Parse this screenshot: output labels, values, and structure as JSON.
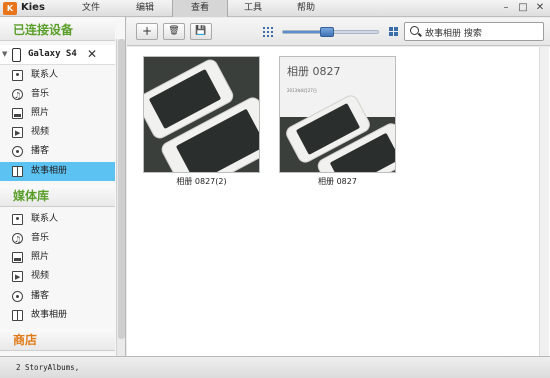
{
  "app": {
    "logo_text": "K",
    "name": "Kies"
  },
  "menu": [
    {
      "label": "文件"
    },
    {
      "label": "编辑"
    },
    {
      "label": "查看",
      "active": true
    },
    {
      "label": "工具"
    },
    {
      "label": "帮助"
    }
  ],
  "window": {
    "minimize": "–",
    "maximize": "□",
    "close": "✕"
  },
  "sidebar": {
    "connected_header": "已连接设备",
    "device": {
      "name": "Galaxy S4",
      "collapse_glyph": "▼",
      "close_glyph": "✕"
    },
    "device_items": [
      {
        "label": "联系人",
        "icon": "contact-icon"
      },
      {
        "label": "音乐",
        "icon": "music-icon"
      },
      {
        "label": "照片",
        "icon": "photo-icon"
      },
      {
        "label": "视频",
        "icon": "video-icon"
      },
      {
        "label": "播客",
        "icon": "podcast-icon"
      },
      {
        "label": "故事相册",
        "icon": "story-album-icon",
        "selected": true
      }
    ],
    "library_header": "媒体库",
    "library_items": [
      {
        "label": "联系人",
        "icon": "contact-icon"
      },
      {
        "label": "音乐",
        "icon": "music-icon"
      },
      {
        "label": "照片",
        "icon": "photo-icon"
      },
      {
        "label": "视频",
        "icon": "video-icon"
      },
      {
        "label": "播客",
        "icon": "podcast-icon"
      },
      {
        "label": "故事相册",
        "icon": "story-album-icon"
      }
    ],
    "store_header": "商店"
  },
  "toolbar": {
    "add_glyph": "+",
    "delete_glyph": "🗑",
    "save_glyph": "💾",
    "search_value": "故事相册 搜索"
  },
  "albums": [
    {
      "label": "相册 0827(2)"
    },
    {
      "label": "相册 0827",
      "card_title": "相册 0827",
      "card_sub": "2013年8月27日"
    }
  ],
  "status": {
    "text": "2 StoryAlbums,"
  },
  "colors": {
    "selected": "#5cc2f2",
    "header_green": "#5b9f2b",
    "store_orange": "#e07a18",
    "logo": "#e8741c"
  }
}
